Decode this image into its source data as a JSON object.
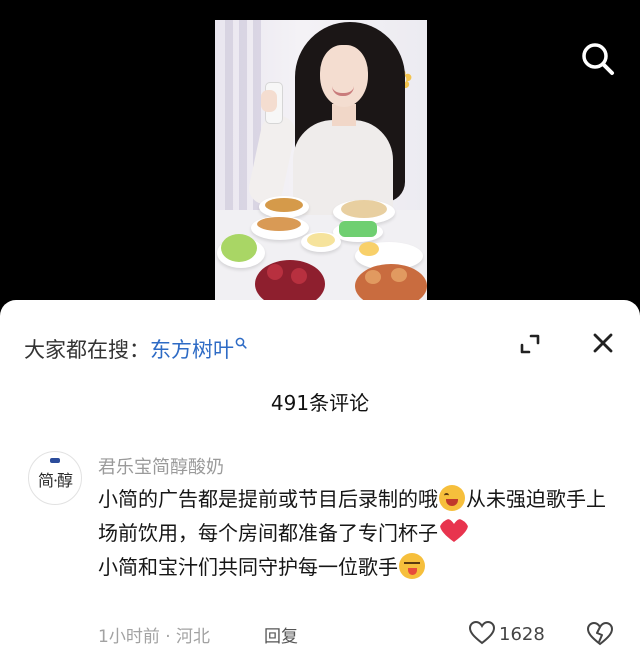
{
  "video": {
    "search_icon": "search-icon"
  },
  "panel": {
    "hot_search_prefix": "大家都在搜：",
    "hot_search_term": "东方树叶",
    "comment_count_label": "491条评论"
  },
  "comment": {
    "avatar_text": "简·醇",
    "username": "君乐宝简醇酸奶",
    "line1": "小简的广告都是提前或节目后录制的哦",
    "line1_tail": "从未强迫歌手上场前饮用，每个房间都准备了专门杯子",
    "line2": "小简和宝汁们共同守护每一位歌手",
    "time": "1小时前",
    "separator": "·",
    "location": "河北",
    "reply_label": "回复",
    "like_count": "1628"
  },
  "colors": {
    "hot_term": "#2e6bc5",
    "heart": "#e8344e",
    "panel_bg": "#ffffff",
    "video_bg": "#000000"
  }
}
